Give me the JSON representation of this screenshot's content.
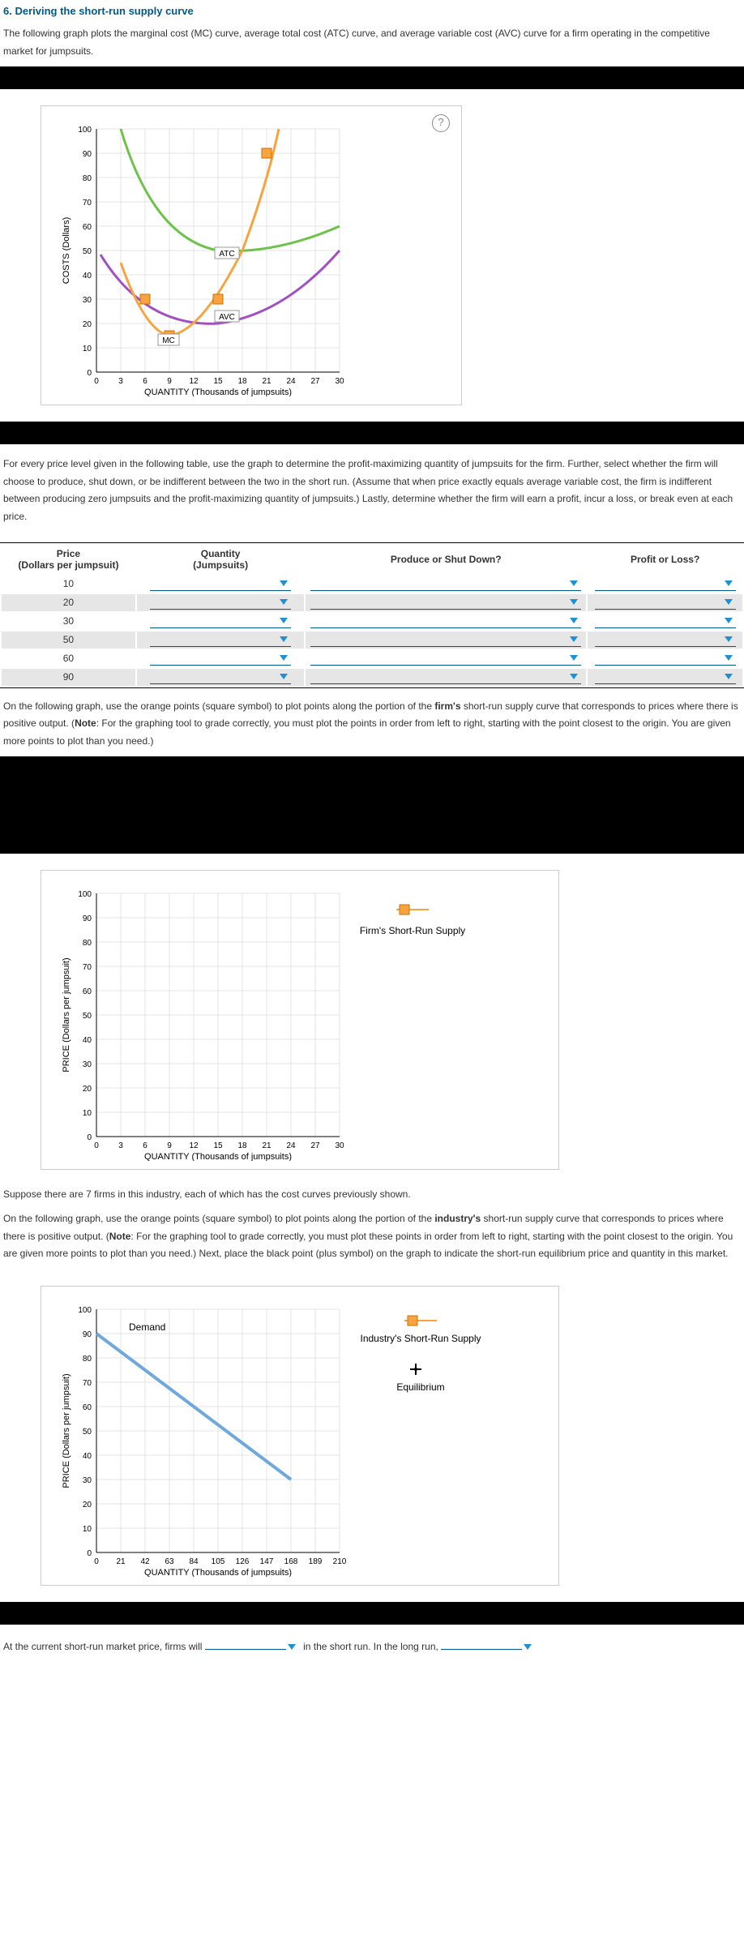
{
  "title": "6. Deriving the short-run supply curve",
  "intro": "The following graph plots the marginal cost (MC) curve, average total cost (ATC) curve, and average variable cost (AVC) curve for a firm operating in the competitive market for jumpsuits.",
  "graph1": {
    "ylabel": "COSTS (Dollars)",
    "xlabel": "QUANTITY (Thousands of jumpsuits)",
    "yticks": [
      "0",
      "10",
      "20",
      "30",
      "40",
      "50",
      "60",
      "70",
      "80",
      "90",
      "100"
    ],
    "xticks": [
      "0",
      "3",
      "6",
      "9",
      "12",
      "15",
      "18",
      "21",
      "24",
      "27",
      "30"
    ],
    "atc_label": "ATC",
    "avc_label": "AVC",
    "mc_label": "MC"
  },
  "para2": "For every price level given in the following table, use the graph to determine the profit-maximizing quantity of jumpsuits for the firm. Further, select whether the firm will choose to produce, shut down, or be indifferent between the two in the short run. (Assume that when price exactly equals average variable cost, the firm is indifferent between producing zero jumpsuits and the profit-maximizing quantity of jumpsuits.) Lastly, determine whether the firm will earn a profit, incur a loss, or break even at each price.",
  "table": {
    "h1a": "Price",
    "h1b": "(Dollars per jumpsuit)",
    "h2a": "Quantity",
    "h2b": "(Jumpsuits)",
    "h3": "Produce or Shut Down?",
    "h4": "Profit or Loss?",
    "rows": [
      "10",
      "20",
      "30",
      "50",
      "60",
      "90"
    ]
  },
  "para3_a": "On the following graph, use the orange points (square symbol) to plot points along the portion of the ",
  "para3_b": "firm's",
  "para3_c": " short-run supply curve that corresponds to prices where there is positive output. (",
  "para3_d": "Note",
  "para3_e": ": For the graphing tool to grade correctly, you must plot the points in order from left to right, starting with the point closest to the origin. You are given more points to plot than you need.)",
  "graph2": {
    "ylabel": "PRICE (Dollars per jumpsuit)",
    "xlabel": "QUANTITY (Thousands of jumpsuits)",
    "yticks": [
      "0",
      "10",
      "20",
      "30",
      "40",
      "50",
      "60",
      "70",
      "80",
      "90",
      "100"
    ],
    "xticks": [
      "0",
      "3",
      "6",
      "9",
      "12",
      "15",
      "18",
      "21",
      "24",
      "27",
      "30"
    ],
    "legend": "Firm's Short-Run Supply"
  },
  "para4": "Suppose there are 7 firms in this industry, each of which has the cost curves previously shown.",
  "para5_a": "On the following graph, use the orange points (square symbol) to plot points along the portion of the ",
  "para5_b": "industry's",
  "para5_c": " short-run supply curve that corresponds to prices where there is positive output. (",
  "para5_d": "Note",
  "para5_e": ": For the graphing tool to grade correctly, you must plot these points in order from left to right, starting with the point closest to the origin. You are given more points to plot than you need.) Next, place the black point (plus symbol) on the graph to indicate the short-run equilibrium price and quantity in this market.",
  "graph3": {
    "ylabel": "PRICE (Dollars per jumpsuit)",
    "xlabel": "QUANTITY (Thousands of jumpsuits)",
    "yticks": [
      "0",
      "10",
      "20",
      "30",
      "40",
      "50",
      "60",
      "70",
      "80",
      "90",
      "100"
    ],
    "xticks": [
      "0",
      "21",
      "42",
      "63",
      "84",
      "105",
      "126",
      "147",
      "168",
      "189",
      "210"
    ],
    "demand": "Demand",
    "legend1": "Industry's Short-Run Supply",
    "legend2": "Equilibrium"
  },
  "bottom_a": "At the current short-run market price, firms will ",
  "bottom_b": " in the short run. In the long run, ",
  "chart_data": [
    {
      "type": "line",
      "chart": "costs",
      "title": "",
      "xlabel": "QUANTITY (Thousands of jumpsuits)",
      "ylabel": "COSTS (Dollars)",
      "xlim": [
        0,
        30
      ],
      "ylim": [
        0,
        100
      ],
      "series": [
        {
          "name": "MC",
          "color": "#f7a440",
          "x": [
            3,
            6,
            9,
            12,
            15,
            18,
            21,
            24
          ],
          "y": [
            45,
            30,
            15,
            20,
            30,
            50,
            90,
            100
          ],
          "markers_at": [
            6,
            15,
            21
          ]
        },
        {
          "name": "ATC",
          "color": "#6ec24a",
          "x": [
            3,
            9,
            15,
            18,
            24,
            30
          ],
          "y": [
            100,
            60,
            50,
            50,
            55,
            60
          ]
        },
        {
          "name": "AVC",
          "color": "#a050c0",
          "x": [
            1,
            6,
            12,
            15,
            18,
            24,
            30
          ],
          "y": [
            48,
            30,
            20,
            20,
            22,
            35,
            50
          ]
        }
      ]
    },
    {
      "type": "scatter",
      "chart": "firm_supply",
      "title": "Firm's Short-Run Supply",
      "xlabel": "QUANTITY (Thousands of jumpsuits)",
      "ylabel": "PRICE (Dollars per jumpsuit)",
      "xlim": [
        0,
        30
      ],
      "ylim": [
        0,
        100
      ],
      "series": []
    },
    {
      "type": "line",
      "chart": "industry",
      "title": "",
      "xlabel": "QUANTITY (Thousands of jumpsuits)",
      "ylabel": "PRICE (Dollars per jumpsuit)",
      "xlim": [
        0,
        210
      ],
      "ylim": [
        0,
        100
      ],
      "series": [
        {
          "name": "Demand",
          "color": "#6fa8dc",
          "x": [
            0,
            168
          ],
          "y": [
            90,
            30
          ]
        }
      ],
      "legend": [
        "Industry's Short-Run Supply",
        "Equilibrium"
      ]
    }
  ]
}
